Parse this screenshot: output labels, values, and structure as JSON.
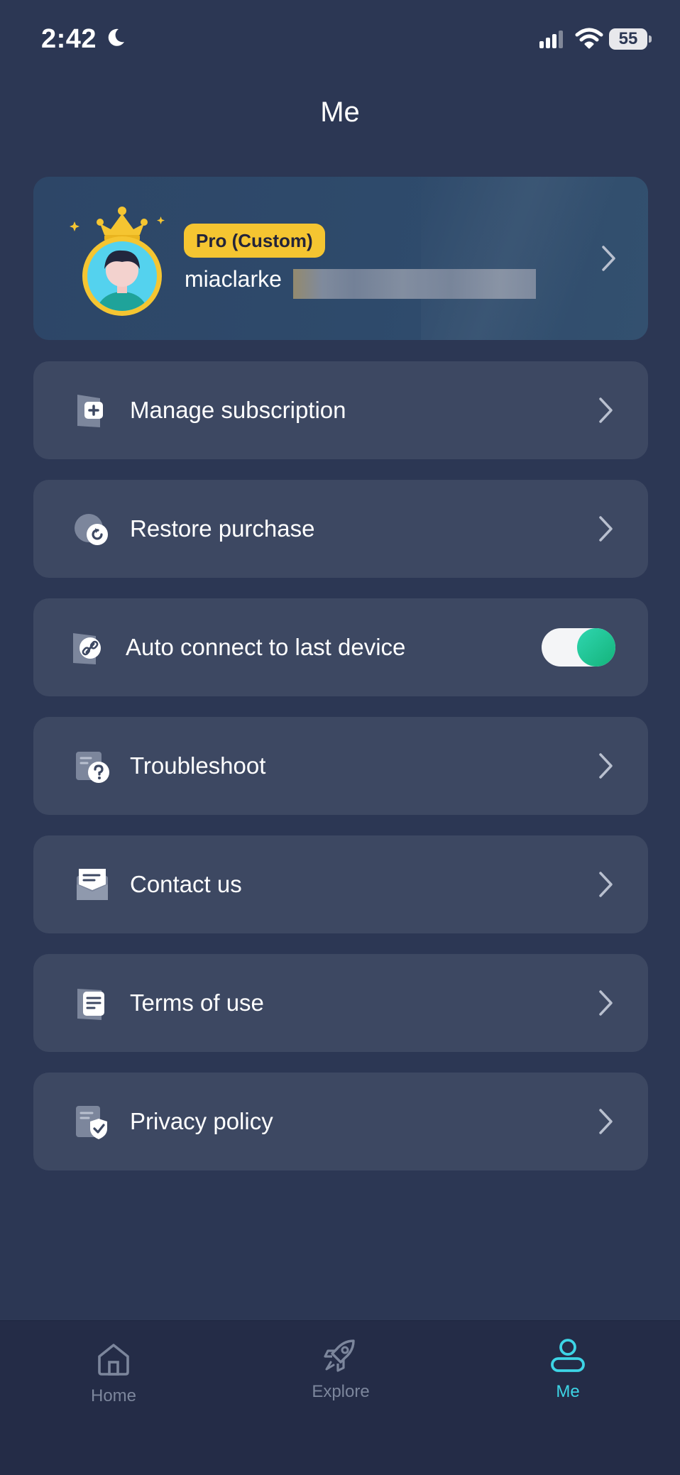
{
  "status_bar": {
    "time": "2:42",
    "battery": "55"
  },
  "header": {
    "title": "Me"
  },
  "profile": {
    "badge": "Pro (Custom)",
    "username": "miaclarke"
  },
  "menu": [
    {
      "label": "Manage subscription",
      "icon": "subscription-icon"
    },
    {
      "label": "Restore purchase",
      "icon": "restore-icon"
    },
    {
      "label": "Auto connect to last device",
      "icon": "link-icon",
      "toggle_on": true
    },
    {
      "label": "Troubleshoot",
      "icon": "troubleshoot-icon"
    },
    {
      "label": "Contact us",
      "icon": "mail-icon"
    },
    {
      "label": "Terms of use",
      "icon": "document-icon"
    },
    {
      "label": "Privacy policy",
      "icon": "shield-document-icon"
    }
  ],
  "tabs": [
    {
      "label": "Home",
      "icon": "home-icon",
      "active": false
    },
    {
      "label": "Explore",
      "icon": "rocket-icon",
      "active": false
    },
    {
      "label": "Me",
      "icon": "person-icon",
      "active": true
    }
  ],
  "colors": {
    "background": "#2c3754",
    "row": "#3d4862",
    "accent": "#3dd5e6",
    "badge": "#f5c531",
    "toggle": "#14b37a"
  }
}
